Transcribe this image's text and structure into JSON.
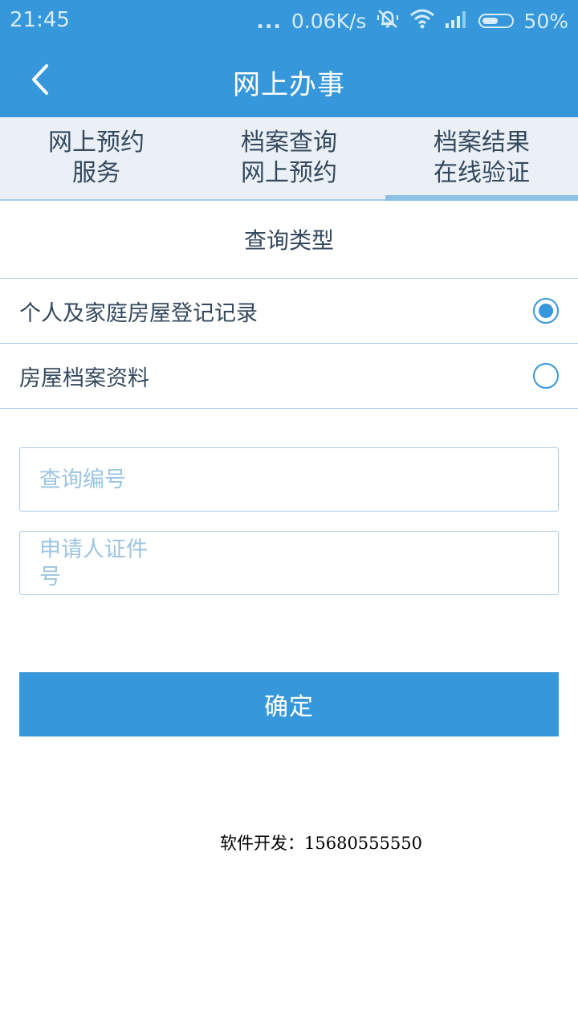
{
  "status_bar": {
    "time": "21:45",
    "dots": "...",
    "network_speed": "0.06K/s",
    "battery_percent": "50%",
    "battery_level": 0.5,
    "icons": [
      "mute-vibrate-icon",
      "wifi-icon",
      "signal-icon",
      "battery-icon"
    ]
  },
  "app_bar": {
    "title": "网上办事",
    "back_icon": "chevron-left-icon"
  },
  "tabs": [
    {
      "line1": "网上预约",
      "line2": "服务",
      "active": false
    },
    {
      "line1": "档案查询",
      "line2": "网上预约",
      "active": false
    },
    {
      "line1": "档案结果",
      "line2": "在线验证",
      "active": true
    }
  ],
  "query": {
    "section_title": "查询类型",
    "options": [
      {
        "label": "个人及家庭房屋登记记录",
        "selected": true
      },
      {
        "label": "房屋档案资料",
        "selected": false
      }
    ],
    "query_number_placeholder": "查询编号",
    "id_number_placeholder": "申请人证件号",
    "confirm_label": "确定"
  },
  "footer": {
    "text": "软件开发：15680555550"
  },
  "colors": {
    "primary": "#3698db",
    "tab_background": "#eaf0f6",
    "border": "#a9cde9",
    "placeholder": "#9cc4e2",
    "text": "#34495e"
  }
}
